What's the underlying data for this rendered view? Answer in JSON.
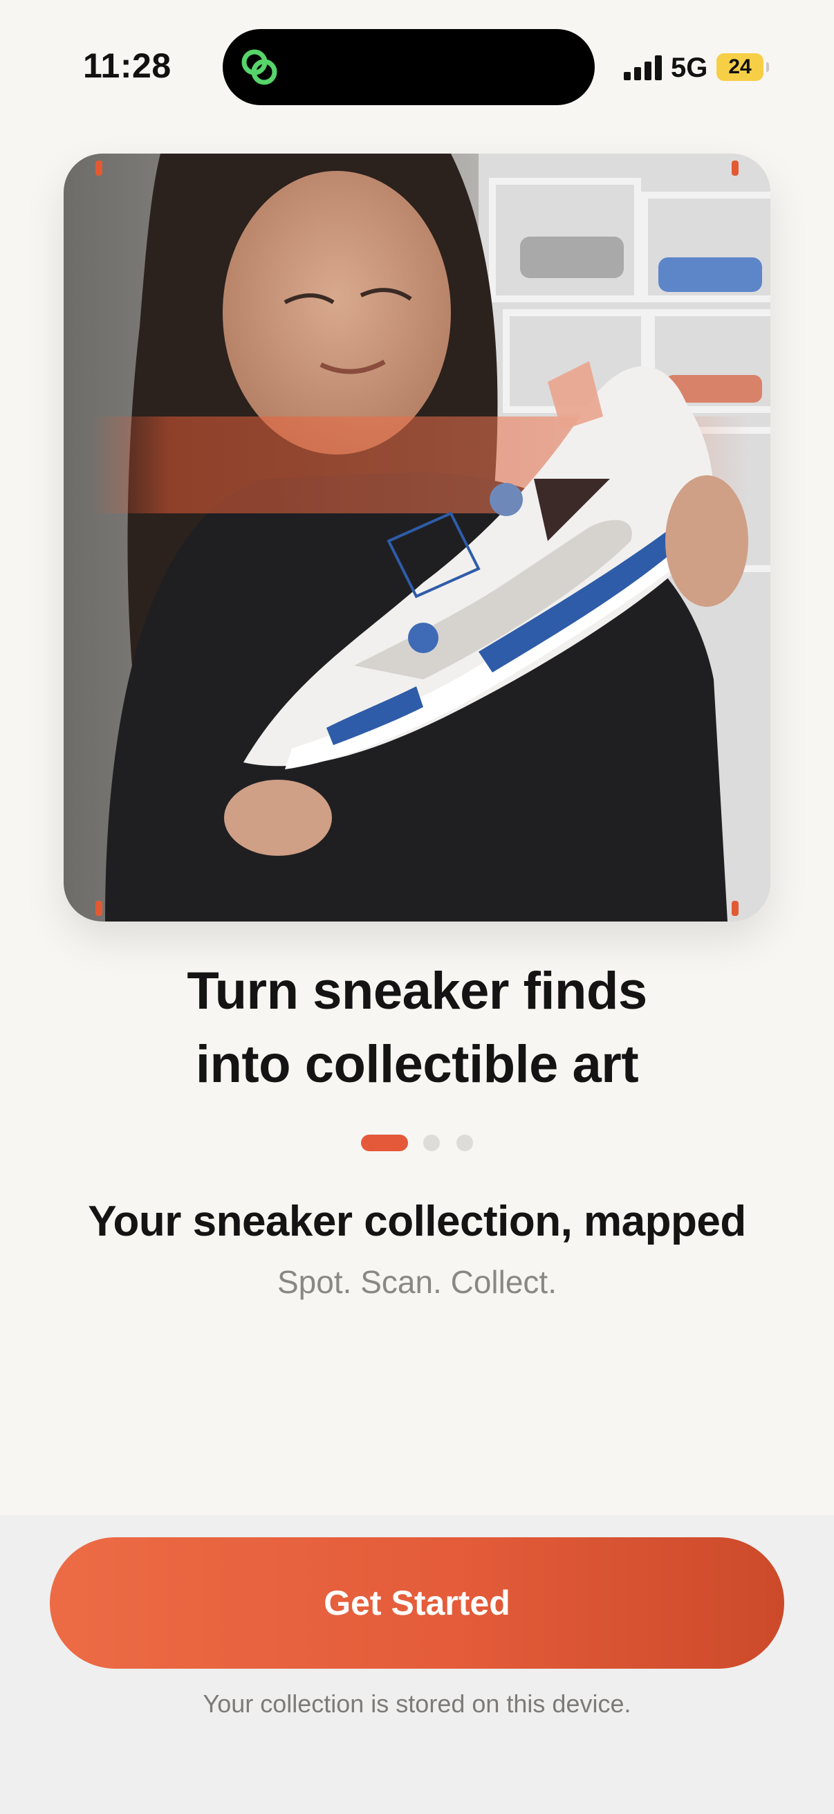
{
  "status_bar": {
    "time": "11:28",
    "network": "5G",
    "battery": "24",
    "island_app_icon": "link-rings-icon"
  },
  "hero": {
    "image": "person-holding-sneaker-photo",
    "scan_accent_color": "#e25a34"
  },
  "onboarding": {
    "headline_line1": "Turn sneaker finds",
    "headline_line2": "into collectible art",
    "page_indicator": {
      "total": 3,
      "current": 1
    },
    "subheadline": "Your sneaker collection, mapped",
    "tagline": "Spot. Scan. Collect."
  },
  "cta": {
    "label": "Get Started",
    "color_start": "#ec6b45",
    "color_end": "#cc4a2a"
  },
  "footer": {
    "note": "Your collection is stored on this device."
  }
}
